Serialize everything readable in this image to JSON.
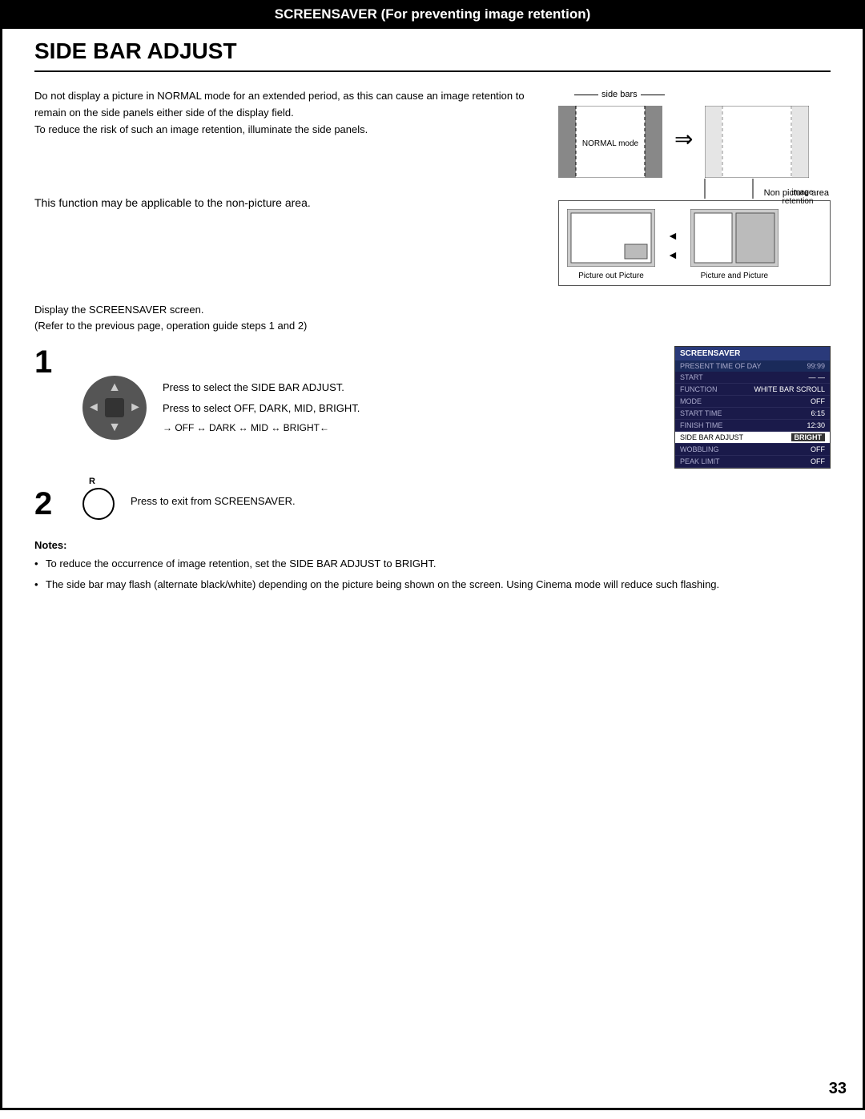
{
  "page": {
    "top_bar_title": "SCREENSAVER (For preventing image retention)",
    "page_title": "SIDE BAR ADJUST",
    "page_number": "33"
  },
  "section1": {
    "description": "Do not display a picture in NORMAL mode for an extended period, as this can cause an image retention to remain on the side panels either side of the display field.\nTo reduce the risk of such an image retention, illuminate the side panels.",
    "diagram": {
      "side_bars_label": "side bars",
      "normal_mode_label": "NORMAL mode",
      "image_retention_label1": "image",
      "image_retention_label2": "retention"
    }
  },
  "section2": {
    "description": "This function may be applicable to the non-picture area.",
    "diagram": {
      "non_picture_label": "Non picture area",
      "picture_out_label": "Picture out Picture",
      "picture_and_label": "Picture and Picture"
    }
  },
  "steps_intro": {
    "line1": "Display the SCREENSAVER screen.",
    "line2": "(Refer to the previous page, operation guide steps 1 and 2)"
  },
  "step1": {
    "number": "1",
    "instruction1": "Press to select the SIDE BAR ADJUST.",
    "instruction2": "Press to select OFF, DARK, MID, BRIGHT.",
    "submenu": "→ OFF ↔ DARK ↔ MID ↔ BRIGHT←"
  },
  "step2": {
    "number": "2",
    "button_label": "R",
    "instruction": "Press to exit from SCREENSAVER."
  },
  "screensaver_menu": {
    "title": "SCREENSAVER",
    "present_time": "PRESENT  TIME OF DAY",
    "present_value": "99:99",
    "start_label": "START",
    "start_value": "— —",
    "function_label": "FUNCTION",
    "function_value": "WHITE BAR SCROLL",
    "mode_label": "MODE",
    "mode_value": "OFF",
    "start_time_label": "START TIME",
    "start_time_value": "6:15",
    "finish_time_label": "FINISH TIME",
    "finish_time_value": "12:30",
    "side_bar_label": "SIDE BAR ADJUST",
    "side_bar_value": "BRIGHT",
    "wobbling_label": "WOBBLING",
    "wobbling_value": "OFF",
    "peak_limit_label": "PEAK LIMIT",
    "peak_limit_value": "OFF"
  },
  "notes": {
    "title": "Notes:",
    "note1": "To reduce the occurrence of image retention, set the SIDE BAR ADJUST to BRIGHT.",
    "note2": "The side bar may flash (alternate black/white) depending on the picture being shown on the screen. Using Cinema mode will reduce such flashing."
  }
}
